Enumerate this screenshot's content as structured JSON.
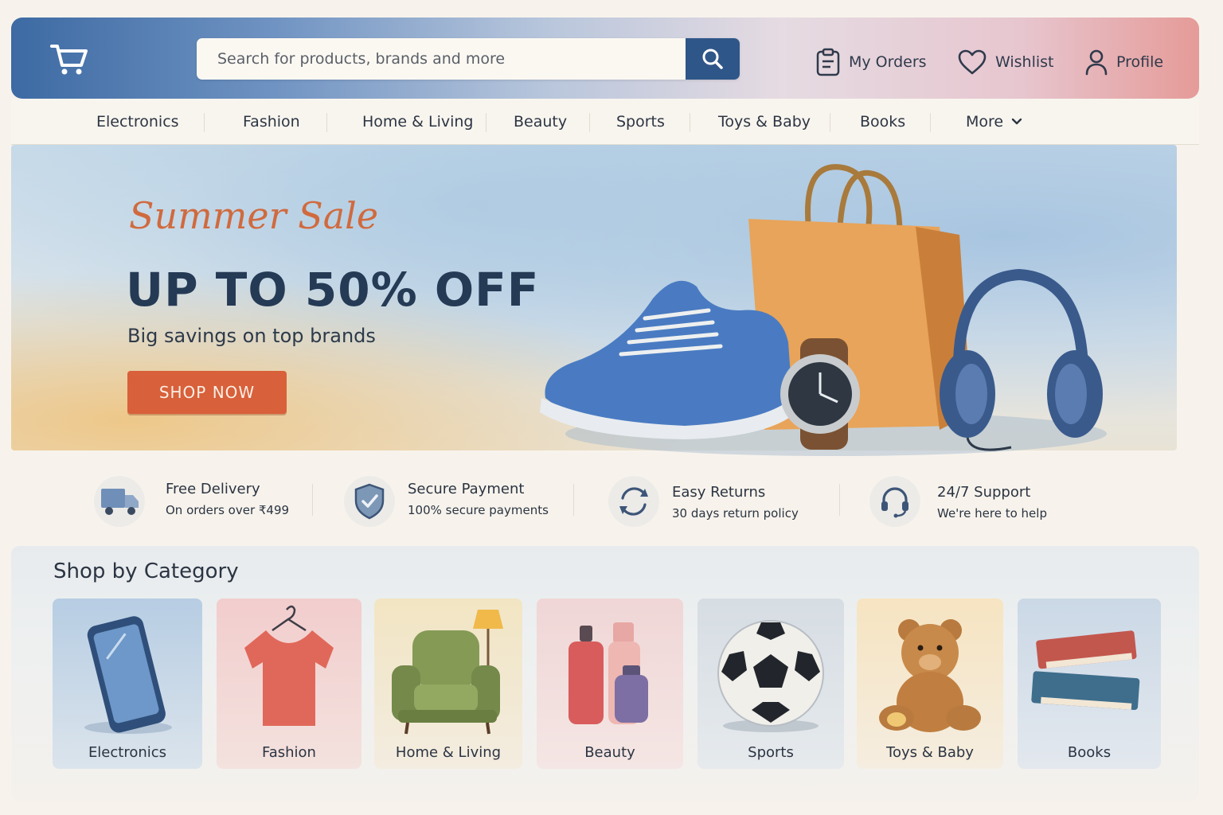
{
  "header": {
    "search_placeholder": "Search for products, brands and more",
    "orders_label": "My Orders",
    "wishlist_label": "Wishlist",
    "profile_label": "Profile"
  },
  "nav": {
    "items": [
      "Electronics",
      "Fashion",
      "Home & Living",
      "Beauty",
      "Sports",
      "Toys & Baby",
      "Books",
      "More"
    ]
  },
  "hero": {
    "script": "Summer Sale",
    "title": "UP TO 50% OFF",
    "subtitle": "Big savings on top brands",
    "cta": "SHOP NOW"
  },
  "features": [
    {
      "title": "Free Delivery",
      "subtitle": "On orders over ₹499",
      "icon": "truck-icon"
    },
    {
      "title": "Secure Payment",
      "subtitle": "100% secure payments",
      "icon": "shield-check-icon"
    },
    {
      "title": "Easy Returns",
      "subtitle": "30 days return policy",
      "icon": "return-arrows-icon"
    },
    {
      "title": "24/7 Support",
      "subtitle": "We're here to help",
      "icon": "headset-icon"
    }
  ],
  "categories": {
    "title": "Shop by Category",
    "items": [
      "Electronics",
      "Fashion",
      "Home & Living",
      "Beauty",
      "Sports",
      "Toys & Baby",
      "Books"
    ]
  },
  "colors": {
    "brand_blue": "#2f5688",
    "cta_orange": "#d8603a",
    "heading_navy": "#253a55"
  }
}
